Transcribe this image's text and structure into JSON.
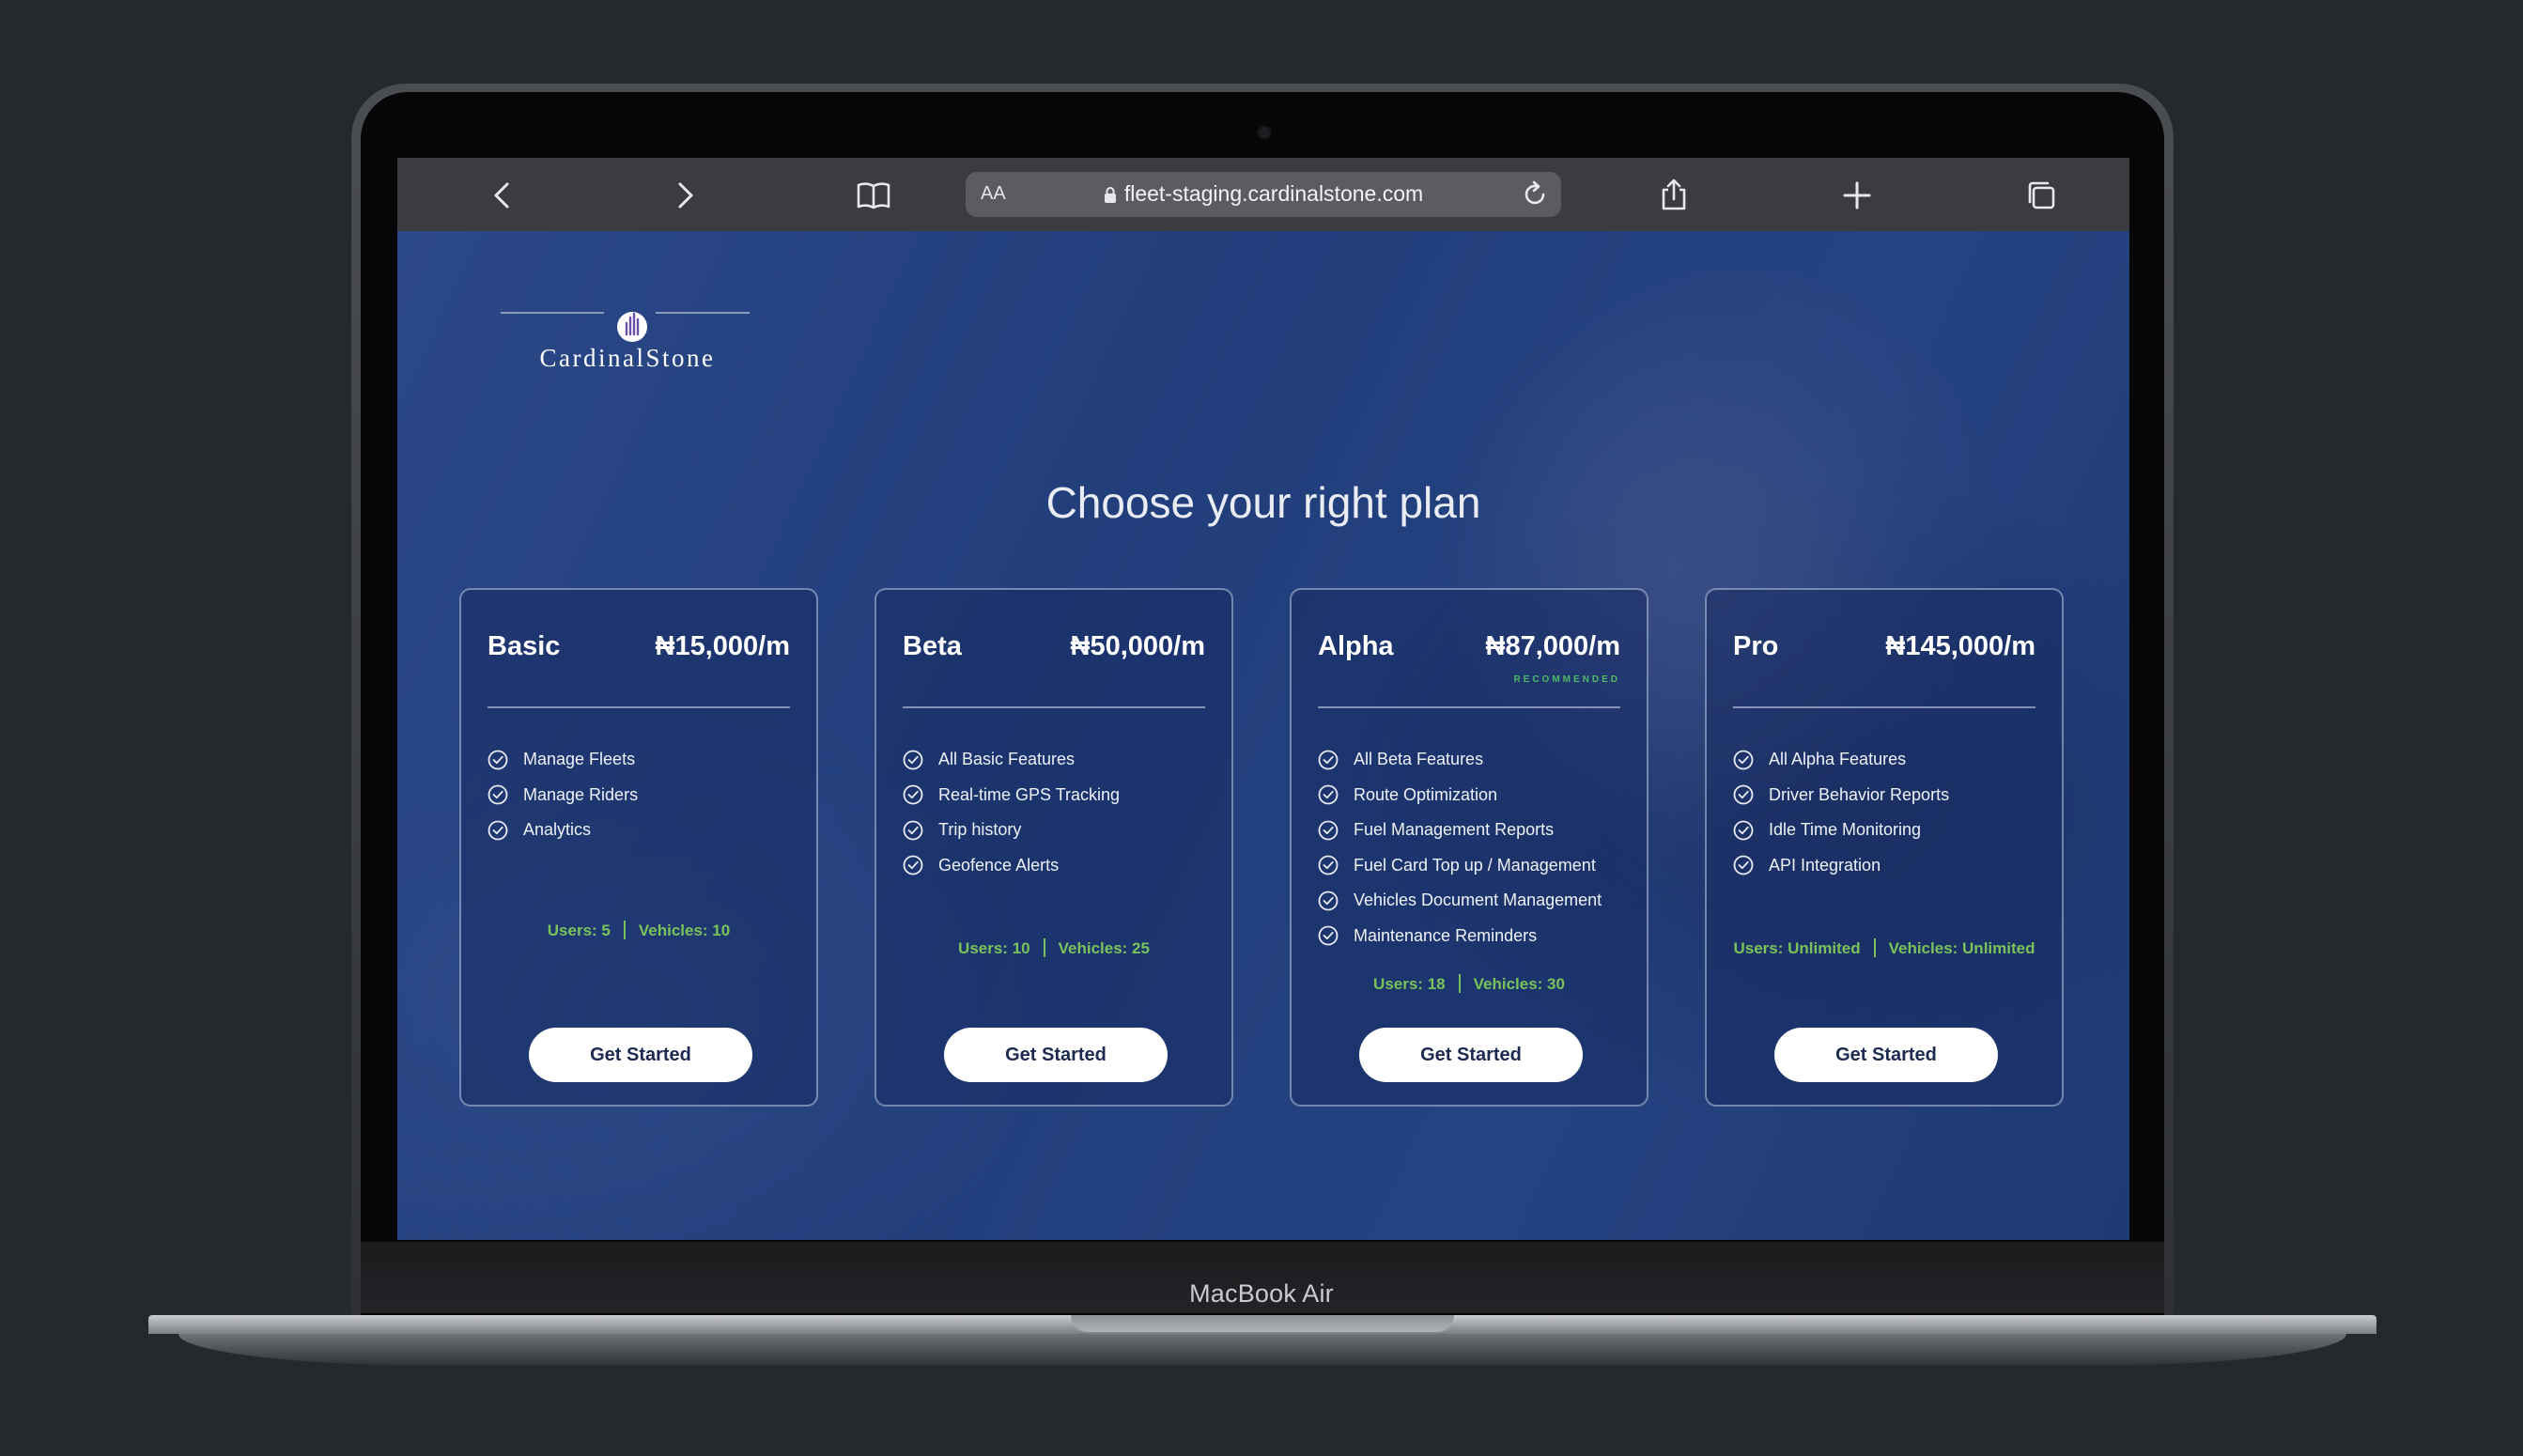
{
  "device": {
    "label": "MacBook Air"
  },
  "browser": {
    "address": {
      "text_size_label": "AA",
      "url": "fleet-staging.cardinalstone.com"
    },
    "icons": {
      "back": "chevron-left-icon",
      "forward": "chevron-right-icon",
      "bookmarks": "book-icon",
      "reload": "reload-icon",
      "share": "share-icon",
      "new_tab": "plus-icon",
      "tabs": "tabs-icon"
    }
  },
  "page": {
    "logo": {
      "text": "CardinalStone"
    },
    "headline": "Choose your right plan",
    "plans": [
      {
        "name": "Basic",
        "price": "₦15,000/m",
        "badge": "",
        "features": [
          "Manage Fleets",
          "Manage Riders",
          "Analytics"
        ],
        "users": "Users: 5",
        "vehicles": "Vehicles: 10",
        "cta": "Get Started"
      },
      {
        "name": "Beta",
        "price": "₦50,000/m",
        "badge": "",
        "features": [
          "All Basic Features",
          "Real-time GPS Tracking",
          "Trip history",
          "Geofence Alerts"
        ],
        "users": "Users: 10",
        "vehicles": "Vehicles: 25",
        "cta": "Get Started"
      },
      {
        "name": "Alpha",
        "price": "₦87,000/m",
        "badge": "RECOMMENDED",
        "features": [
          "All Beta Features",
          "Route Optimization",
          "Fuel Management Reports",
          "Fuel Card Top up / Management",
          "Vehicles Document Management",
          "Maintenance Reminders"
        ],
        "users": "Users: 18",
        "vehicles": "Vehicles: 30",
        "cta": "Get Started"
      },
      {
        "name": "Pro",
        "price": "₦145,000/m",
        "badge": "",
        "features": [
          "All Alpha Features",
          "Driver Behavior Reports",
          "Idle Time Monitoring",
          "API Integration"
        ],
        "users": "Users: Unlimited",
        "vehicles": "Vehicles: Unlimited",
        "cta": "Get Started"
      }
    ]
  },
  "colors": {
    "page_background": "#22407e",
    "accent_green": "#7ac25a",
    "badge_green": "#4fb86a",
    "button_text": "#1b2a4e"
  }
}
